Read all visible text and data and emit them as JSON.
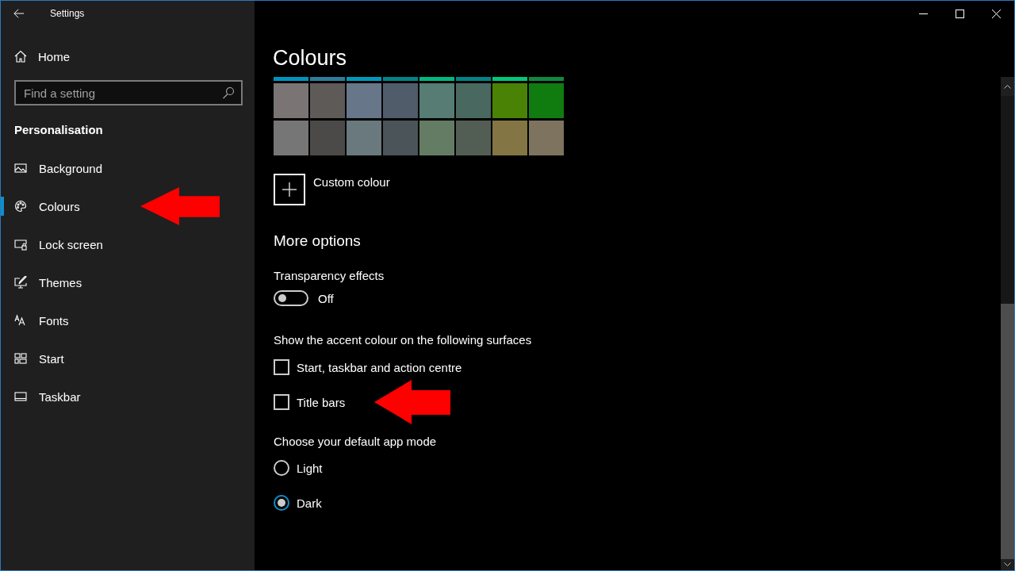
{
  "window": {
    "title": "Settings"
  },
  "sidebar": {
    "home": "Home",
    "search": {
      "placeholder": "Find a setting"
    },
    "section": "Personalisation",
    "items": [
      {
        "label": "Background",
        "selected": false,
        "pointed_at": false
      },
      {
        "label": "Colours",
        "selected": true,
        "pointed_at": true
      },
      {
        "label": "Lock screen",
        "selected": false,
        "pointed_at": false
      },
      {
        "label": "Themes",
        "selected": false,
        "pointed_at": false
      },
      {
        "label": "Fonts",
        "selected": false,
        "pointed_at": false
      },
      {
        "label": "Start",
        "selected": false,
        "pointed_at": false
      },
      {
        "label": "Taskbar",
        "selected": false,
        "pointed_at": false
      }
    ]
  },
  "main": {
    "title": "Colours",
    "swatch_strip": [
      {
        "color": "#0093c0"
      },
      {
        "color": "#2d7d9a"
      },
      {
        "color": "#0099bc"
      },
      {
        "color": "#038387"
      },
      {
        "color": "#00b880"
      },
      {
        "color": "#038387"
      },
      {
        "color": "#00c77a"
      },
      {
        "color": "#10893e"
      }
    ],
    "swatch_rows": [
      [
        {
          "color": "#7a7574"
        },
        {
          "color": "#5d5a58"
        },
        {
          "color": "#68768a"
        },
        {
          "color": "#515c6b"
        },
        {
          "color": "#567c73"
        },
        {
          "color": "#486860"
        },
        {
          "color": "#498205"
        },
        {
          "color": "#107c10"
        }
      ],
      [
        {
          "color": "#767676"
        },
        {
          "color": "#4c4a48"
        },
        {
          "color": "#69797e"
        },
        {
          "color": "#4a5459"
        },
        {
          "color": "#647c64"
        },
        {
          "color": "#525e54"
        },
        {
          "color": "#847545"
        },
        {
          "color": "#7e735f"
        }
      ]
    ],
    "custom_colour": "Custom colour",
    "more_options": "More options",
    "transparency": {
      "label": "Transparency effects",
      "on": false,
      "state_text": "Off"
    },
    "surfaces": {
      "label": "Show the accent colour on the following surfaces",
      "options": [
        {
          "label": "Start, taskbar and action centre",
          "checked": false,
          "pointed_at": false
        },
        {
          "label": "Title bars",
          "checked": false,
          "pointed_at": true
        }
      ]
    },
    "app_mode": {
      "label": "Choose your default app mode",
      "options": [
        {
          "label": "Light",
          "selected": false
        },
        {
          "label": "Dark",
          "selected": true
        }
      ]
    }
  }
}
